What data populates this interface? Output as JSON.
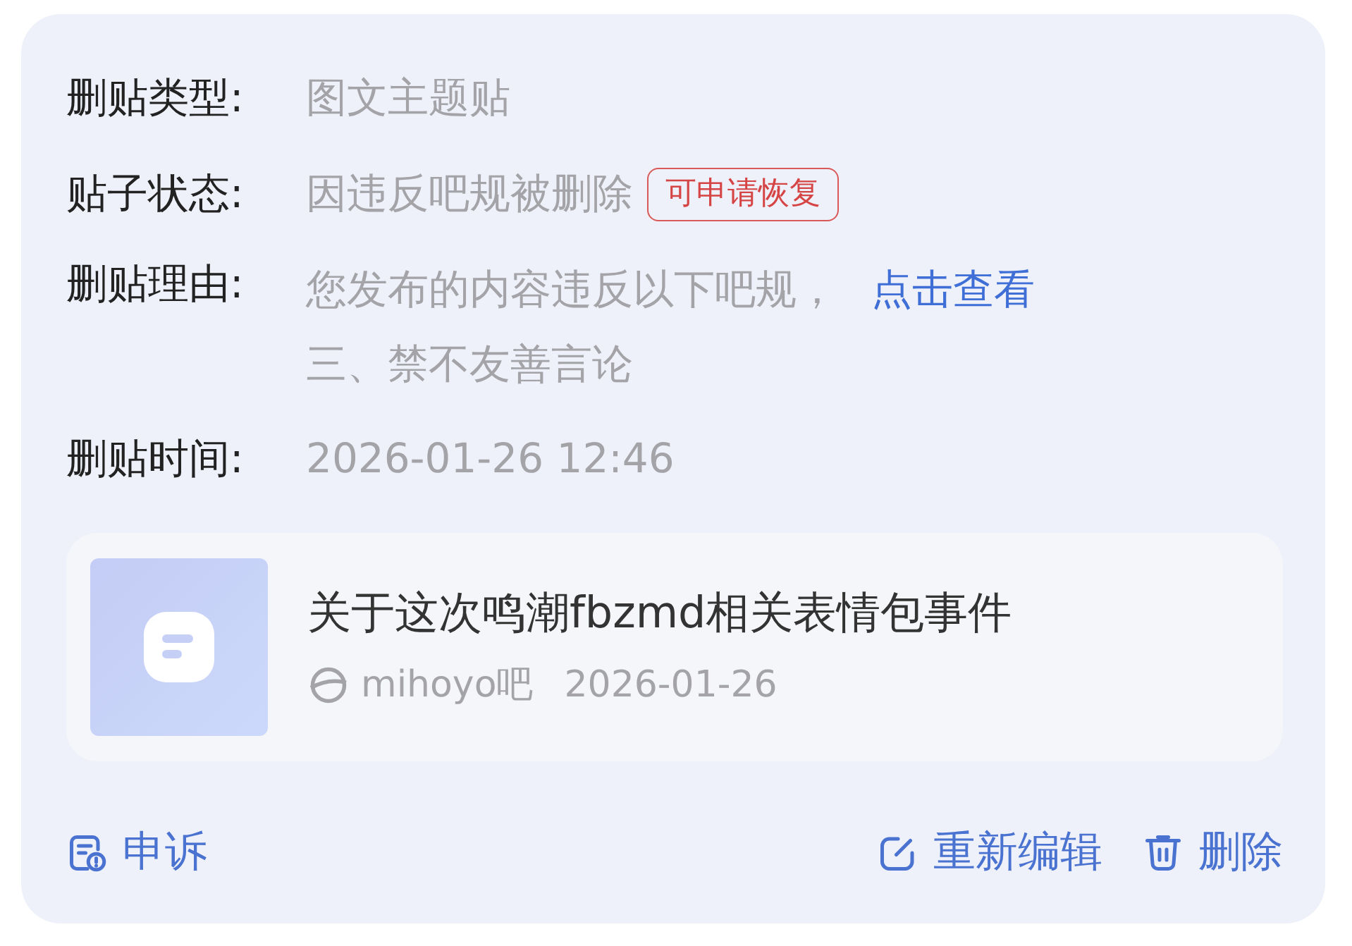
{
  "details": [
    {
      "kind": "plain",
      "label": "删贴类型:",
      "value": "图文主题贴"
    },
    {
      "kind": "badge",
      "label": "贴子状态:",
      "value": "因违反吧规被删除",
      "badge": "可申请恢复"
    },
    {
      "kind": "reason",
      "label": "删贴理由:",
      "value": "您发布的内容违反以下吧规，",
      "link": "点击查看",
      "rule": "三、禁不友善言论"
    },
    {
      "kind": "plain",
      "label": "删贴时间:",
      "value": "2026-01-26 12:46"
    }
  ],
  "post": {
    "title": "关于这次鸣潮fbzmd相关表情包事件",
    "forum": "mihoyo吧",
    "date": "2026-01-26"
  },
  "actions": [
    {
      "kind": "appeal",
      "label": "申诉"
    },
    {
      "kind": "edit",
      "label": "重新编辑"
    },
    {
      "kind": "delete",
      "label": "删除"
    }
  ]
}
